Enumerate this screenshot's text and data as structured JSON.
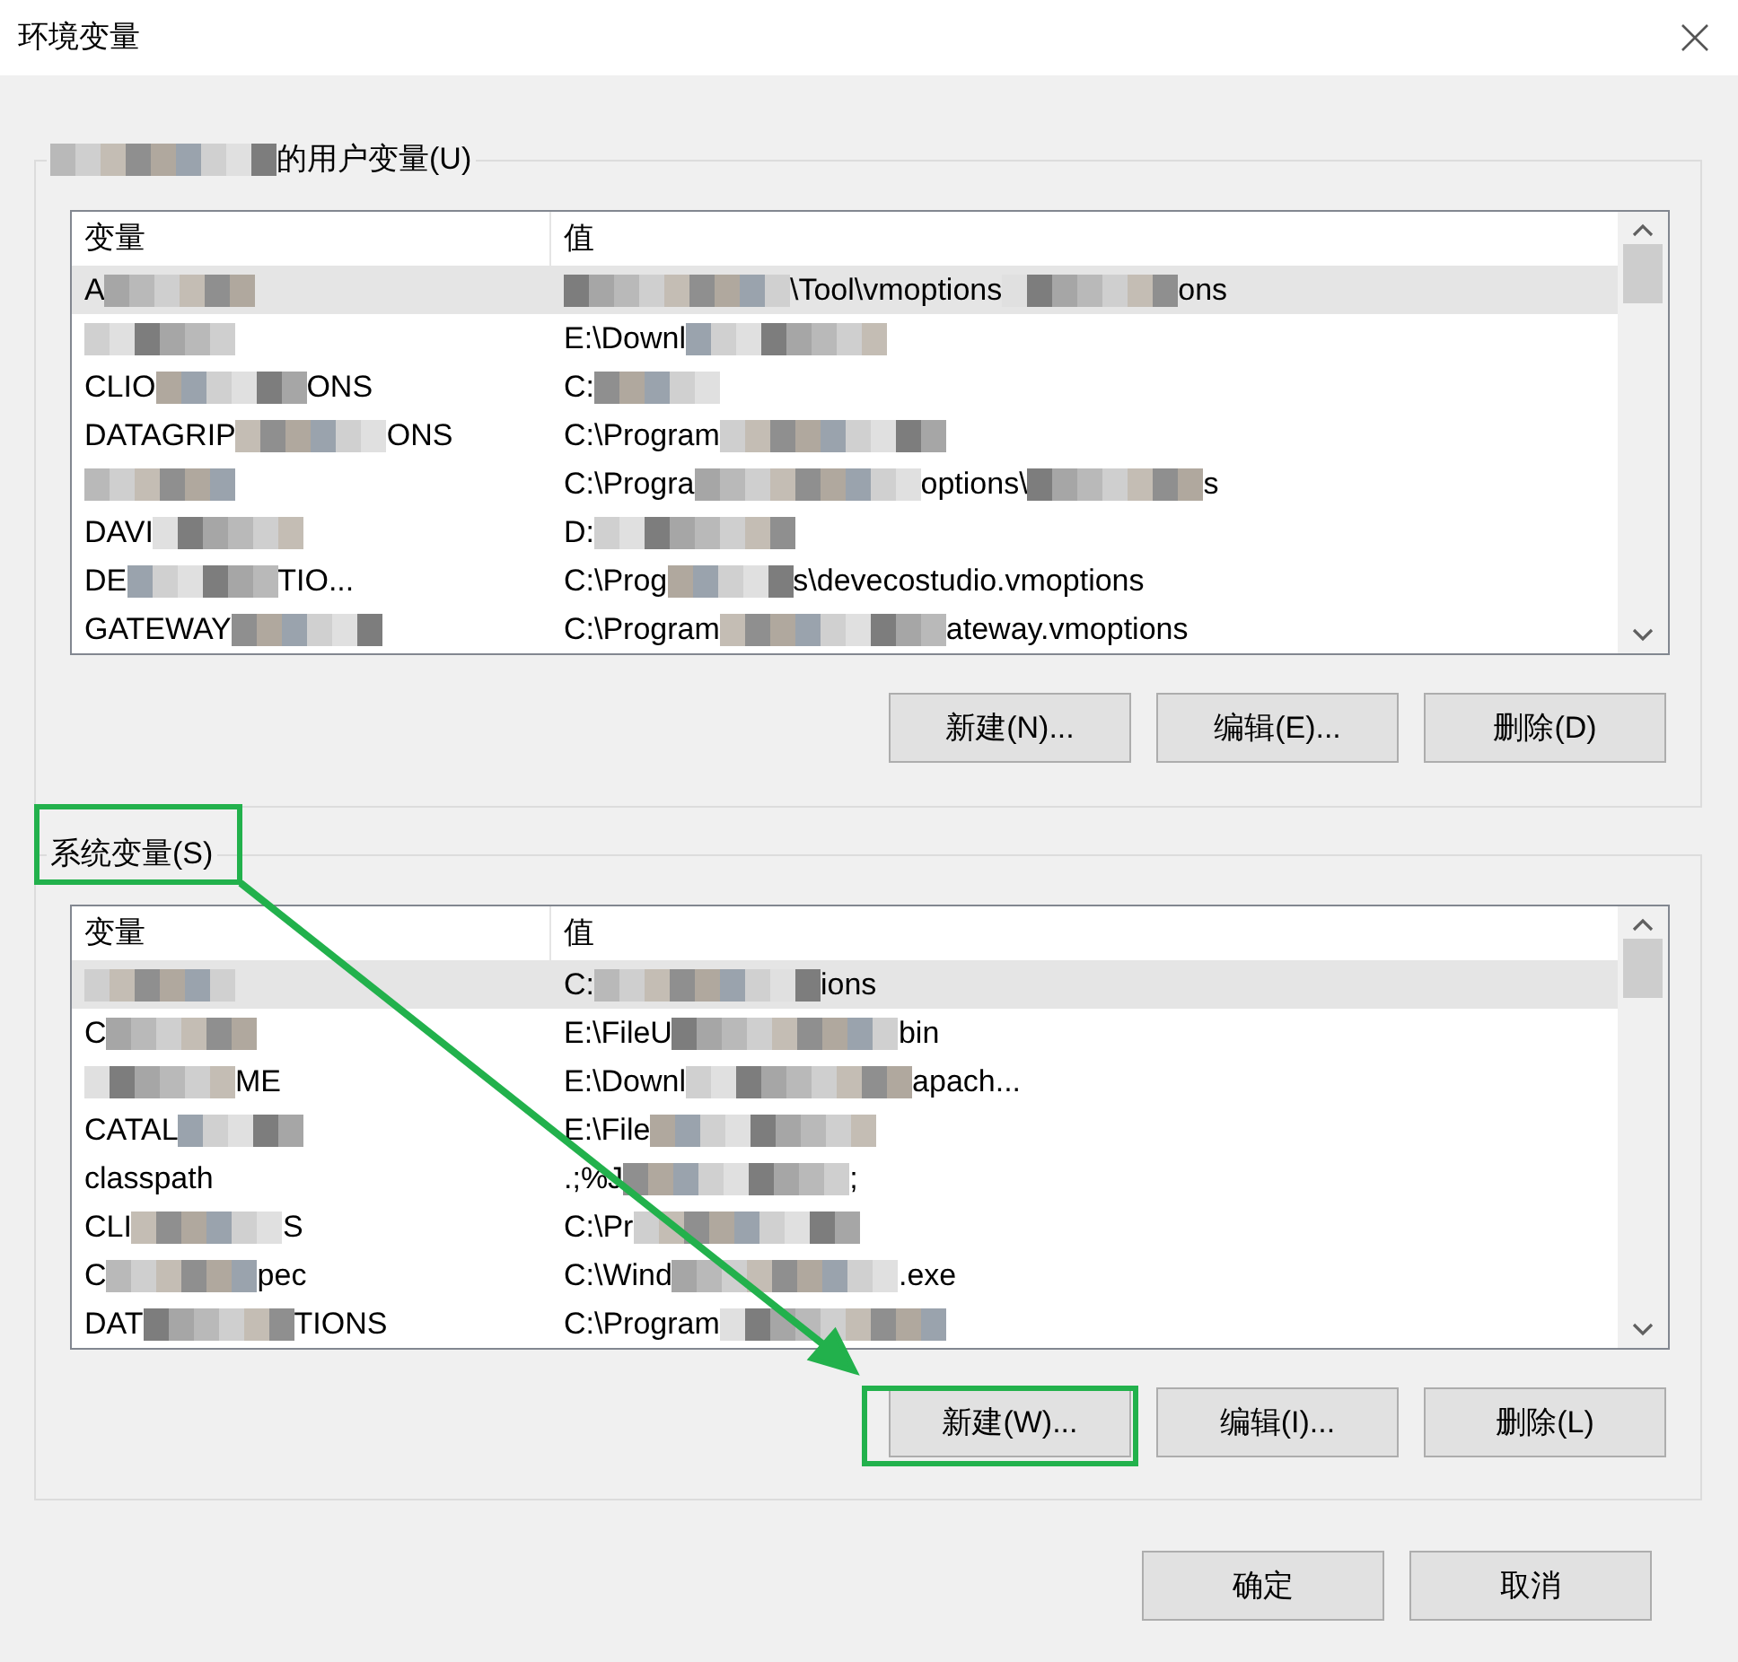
{
  "window": {
    "title": "环境变量"
  },
  "groups": [
    {
      "label": [
        {
          "kind": "masked"
        },
        {
          "text": "的用户变量(U)"
        }
      ],
      "columns": [
        "变量",
        "值"
      ],
      "rows": [
        {
          "selected": true,
          "name": [
            {
              "text": "A"
            },
            {
              "kind": "masked"
            }
          ],
          "value": [
            {
              "kind": "masked"
            },
            {
              "text": "\\Tool\\vmoptions"
            },
            {
              "kind": "masked"
            },
            {
              "text": "ons"
            }
          ]
        },
        {
          "selected": false,
          "name": [
            {
              "kind": "masked"
            }
          ],
          "value": [
            {
              "text": "E:\\Downl"
            },
            {
              "kind": "masked"
            }
          ]
        },
        {
          "selected": false,
          "name": [
            {
              "text": "CLIO"
            },
            {
              "kind": "masked"
            },
            {
              "text": "ONS"
            }
          ],
          "value": [
            {
              "text": "C:"
            },
            {
              "kind": "masked"
            }
          ]
        },
        {
          "selected": false,
          "name": [
            {
              "text": "DATAGRIP"
            },
            {
              "kind": "masked"
            },
            {
              "text": "ONS"
            }
          ],
          "value": [
            {
              "text": "C:\\Program"
            },
            {
              "kind": "masked"
            }
          ]
        },
        {
          "selected": false,
          "name": [
            {
              "kind": "masked"
            }
          ],
          "value": [
            {
              "text": "C:\\Progra"
            },
            {
              "kind": "masked"
            },
            {
              "text": "options\\"
            },
            {
              "kind": "masked"
            },
            {
              "text": "s"
            }
          ]
        },
        {
          "selected": false,
          "name": [
            {
              "text": "DAVI"
            },
            {
              "kind": "masked"
            }
          ],
          "value": [
            {
              "text": "D:"
            },
            {
              "kind": "masked"
            }
          ]
        },
        {
          "selected": false,
          "name": [
            {
              "text": "DE"
            },
            {
              "kind": "masked"
            },
            {
              "text": "TIO..."
            }
          ],
          "value": [
            {
              "text": "C:\\Prog"
            },
            {
              "kind": "masked"
            },
            {
              "text": "s\\devecostudio.vmoptions"
            }
          ]
        },
        {
          "selected": false,
          "name": [
            {
              "text": "GATEWAY"
            },
            {
              "kind": "masked"
            }
          ],
          "value": [
            {
              "text": "C:\\Program"
            },
            {
              "kind": "masked"
            },
            {
              "text": "ateway.vmoptions"
            }
          ]
        }
      ],
      "buttons": [
        "新建(N)...",
        "编辑(E)...",
        "删除(D)"
      ]
    },
    {
      "label": [
        {
          "text": "系统变量(S)"
        }
      ],
      "columns": [
        "变量",
        "值"
      ],
      "rows": [
        {
          "selected": true,
          "name": [
            {
              "kind": "masked"
            }
          ],
          "value": [
            {
              "text": "C:"
            },
            {
              "kind": "masked"
            },
            {
              "text": "ions"
            }
          ]
        },
        {
          "selected": false,
          "name": [
            {
              "text": "C"
            },
            {
              "kind": "masked"
            }
          ],
          "value": [
            {
              "text": "E:\\FileU"
            },
            {
              "kind": "masked"
            },
            {
              "text": "bin"
            }
          ]
        },
        {
          "selected": false,
          "name": [
            {
              "kind": "masked"
            },
            {
              "text": "ME"
            }
          ],
          "value": [
            {
              "text": "E:\\Downl"
            },
            {
              "kind": "masked"
            },
            {
              "text": "apach..."
            }
          ]
        },
        {
          "selected": false,
          "name": [
            {
              "text": "CATAL"
            },
            {
              "kind": "masked"
            }
          ],
          "value": [
            {
              "text": "E:\\File"
            },
            {
              "kind": "masked"
            }
          ]
        },
        {
          "selected": false,
          "name": [
            {
              "text": "classpath"
            }
          ],
          "value": [
            {
              "text": ".;%J"
            },
            {
              "kind": "masked"
            },
            {
              "text": ";"
            }
          ]
        },
        {
          "selected": false,
          "name": [
            {
              "text": "CLI"
            },
            {
              "kind": "masked"
            },
            {
              "text": "S"
            }
          ],
          "value": [
            {
              "text": "C:\\Pr"
            },
            {
              "kind": "masked"
            }
          ]
        },
        {
          "selected": false,
          "name": [
            {
              "text": "C"
            },
            {
              "kind": "masked"
            },
            {
              "text": "pec"
            }
          ],
          "value": [
            {
              "text": "C:\\Wind"
            },
            {
              "kind": "masked"
            },
            {
              "text": ".exe"
            }
          ]
        },
        {
          "selected": false,
          "name": [
            {
              "text": "DAT"
            },
            {
              "kind": "masked"
            },
            {
              "text": "TIONS"
            }
          ],
          "value": [
            {
              "text": "C:\\Program"
            },
            {
              "kind": "masked"
            }
          ]
        }
      ],
      "buttons": [
        "新建(W)...",
        "编辑(I)...",
        "删除(L)"
      ]
    }
  ],
  "buttons": [
    "确定",
    "取消"
  ],
  "annotations": [
    {
      "kind": "box"
    },
    {
      "kind": "box"
    },
    {
      "kind": "arrow"
    }
  ]
}
